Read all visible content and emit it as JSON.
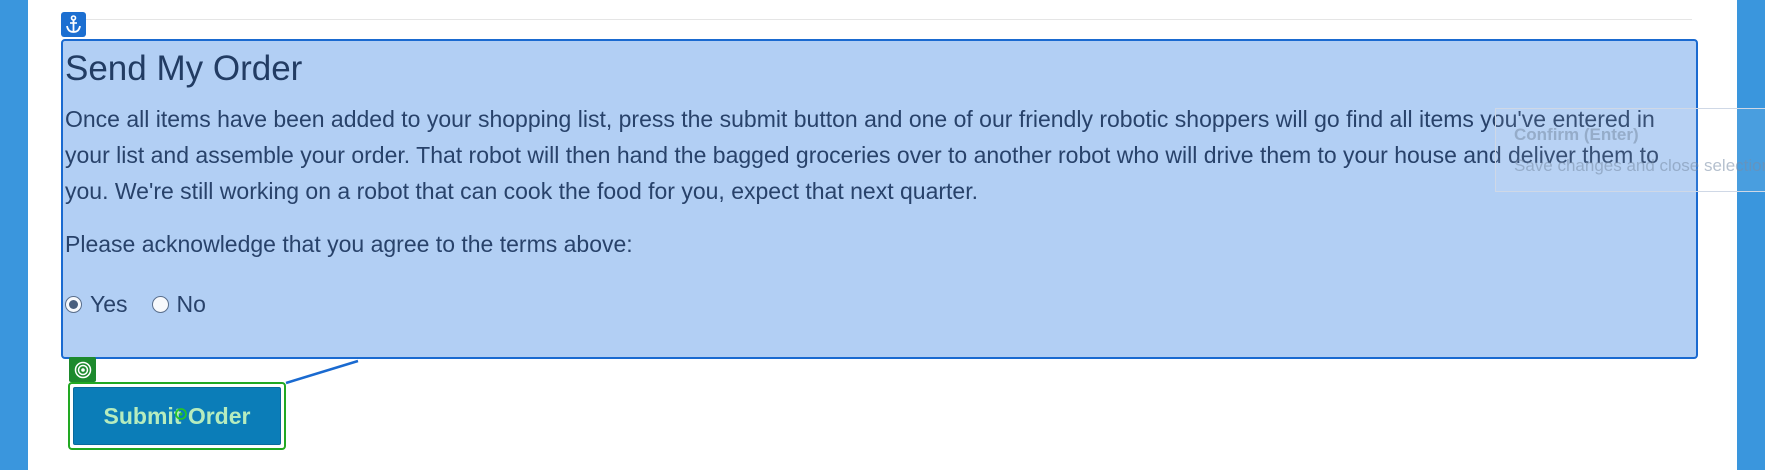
{
  "section": {
    "title": "Send My Order",
    "description": "Once all items have been added to your shopping list, press the submit button and one of our friendly robotic shoppers will go find all items you've entered in your list and assemble your order. That robot will then hand the bagged groceries over to another robot who will drive them to your house and deliver them to you. We're still working on a robot that can cook the food for you, expect that next quarter.",
    "acknowledge_prompt": "Please acknowledge that you agree to the terms above:",
    "options": [
      {
        "label": "Yes",
        "checked": true
      },
      {
        "label": "No",
        "checked": false
      }
    ]
  },
  "tooltip": {
    "title": "Confirm (Enter)",
    "subtitle": "Save changes and close selection"
  },
  "submit": {
    "label": "Submit Order"
  },
  "icons": {
    "anchor_badge": "anchor-icon",
    "target_badge": "target-icon",
    "cursor": "move-cursor-icon"
  },
  "colors": {
    "page_border": "#3a96dd",
    "highlight_fill": "#b3d1f4",
    "highlight_border": "#1a6ad0",
    "target_green": "#1d8a2d",
    "button_blue": "#0b7db8"
  }
}
